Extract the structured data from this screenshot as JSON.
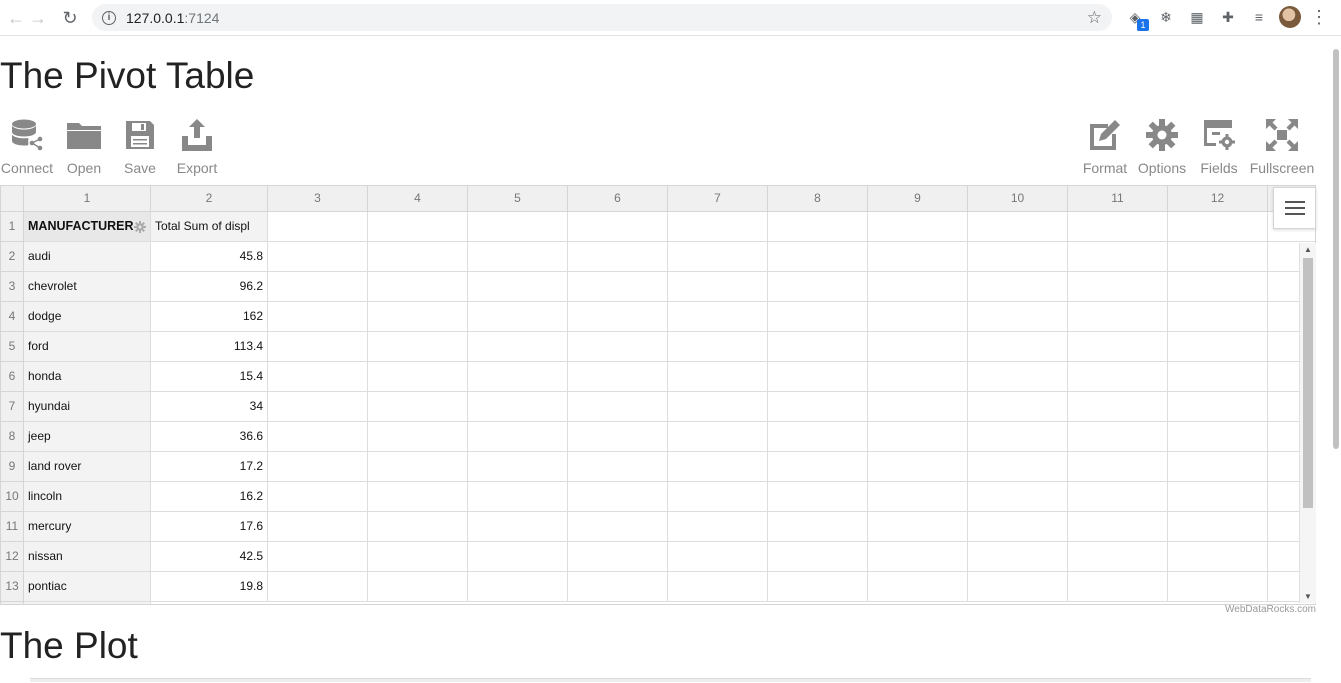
{
  "browser": {
    "url_host": "127.0.0.1",
    "url_port": ":7124",
    "ext_badge": "1"
  },
  "page": {
    "title": "The Pivot Table",
    "plot_title": "The Plot",
    "credit": "WebDataRocks.com"
  },
  "toolbar": {
    "left": [
      {
        "label": "Connect",
        "icon": "database-icon"
      },
      {
        "label": "Open",
        "icon": "folder-icon"
      },
      {
        "label": "Save",
        "icon": "floppy-icon"
      },
      {
        "label": "Export",
        "icon": "export-icon"
      }
    ],
    "right": [
      {
        "label": "Format",
        "icon": "format-icon"
      },
      {
        "label": "Options",
        "icon": "gear-icon"
      },
      {
        "label": "Fields",
        "icon": "fields-icon"
      },
      {
        "label": "Fullscreen",
        "icon": "fullscreen-icon"
      }
    ]
  },
  "grid": {
    "col_numbers": [
      "1",
      "2",
      "3",
      "4",
      "5",
      "6",
      "7",
      "8",
      "9",
      "10",
      "11",
      "12"
    ],
    "row_numbers": [
      "1",
      "2",
      "3",
      "4",
      "5",
      "6",
      "7",
      "8",
      "9",
      "10",
      "11",
      "12",
      "13"
    ],
    "row_field_header": "MANUFACTURER",
    "measure_header": "Total Sum of displ",
    "rows": [
      {
        "manufacturer": "audi",
        "value": "45.8"
      },
      {
        "manufacturer": "chevrolet",
        "value": "96.2"
      },
      {
        "manufacturer": "dodge",
        "value": "162"
      },
      {
        "manufacturer": "ford",
        "value": "113.4"
      },
      {
        "manufacturer": "honda",
        "value": "15.4"
      },
      {
        "manufacturer": "hyundai",
        "value": "34"
      },
      {
        "manufacturer": "jeep",
        "value": "36.6"
      },
      {
        "manufacturer": "land rover",
        "value": "17.2"
      },
      {
        "manufacturer": "lincoln",
        "value": "16.2"
      },
      {
        "manufacturer": "mercury",
        "value": "17.6"
      },
      {
        "manufacturer": "nissan",
        "value": "42.5"
      },
      {
        "manufacturer": "pontiac",
        "value": "19.8"
      }
    ]
  },
  "colors": {
    "toolbar_icon": "#888888",
    "grid_header_bg": "#f0f0f0",
    "grid_border": "#d5d5d5"
  }
}
